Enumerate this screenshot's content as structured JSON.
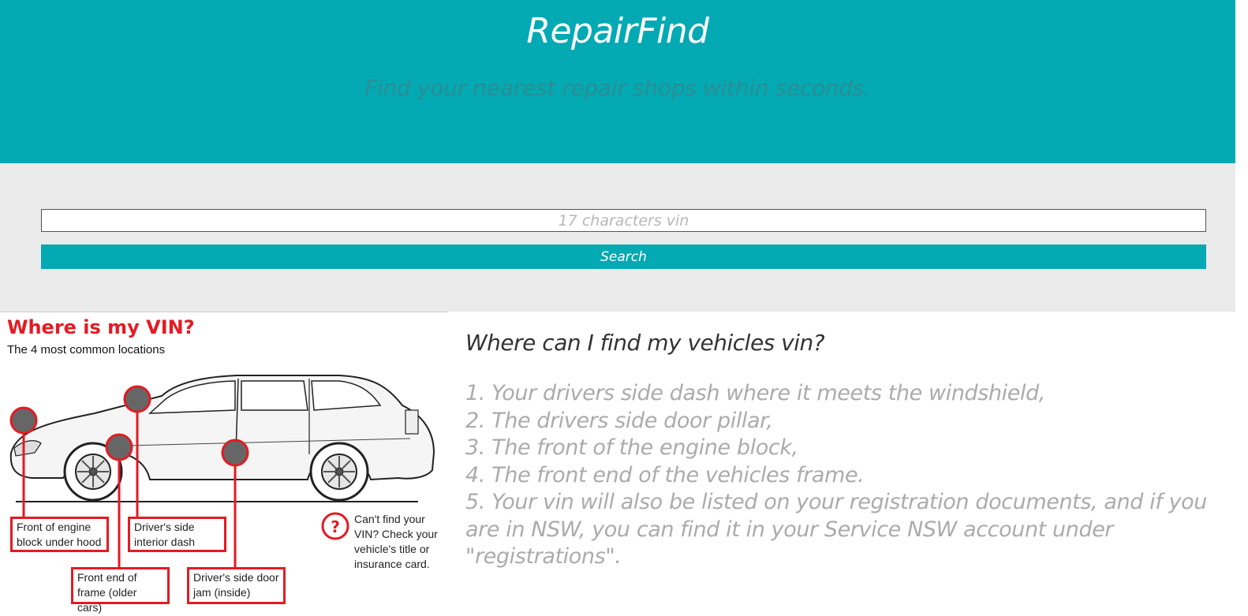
{
  "header": {
    "brand": "RepairFind",
    "tagline": "Find your nearest repair shops within seconds."
  },
  "search": {
    "placeholder": "17 characters vin",
    "value": "",
    "button_label": "Search"
  },
  "vin_figure": {
    "title": "Where is my VIN?",
    "subtitle": "The 4 most common locations",
    "callouts": [
      "Front of engine block under hood",
      "Driver's side interior dash",
      "Front end of frame (older cars)",
      "Driver's side door jam (inside)"
    ],
    "callout_lines": [
      [
        "Front of engine",
        "block under hood"
      ],
      [
        "Driver's side",
        "interior dash"
      ],
      [
        "Front end of",
        "frame (older cars)"
      ],
      [
        "Driver's side door",
        "jam (inside)"
      ]
    ],
    "help_icon": "question-mark-icon",
    "help_text": "Can't find your VIN? Check your vehicle's title or insurance card.",
    "accent_color": "#e31b23"
  },
  "info": {
    "title": "Where can I find my vehicles vin?",
    "steps": [
      "1. Your drivers side dash where it meets the windshield,",
      "2. The drivers side door pillar,",
      "3. The front of the engine block,",
      "4. The front end of the vehicles frame.",
      "5. Your vin will also be listed on your registration documents, and if you are in NSW, you can find it in your Service NSW account under \"registrations\"."
    ]
  },
  "colors": {
    "primary": "#03a9b3",
    "band": "#eaeaea",
    "tagline": "#2a8e93",
    "muted_text": "#ababab"
  }
}
